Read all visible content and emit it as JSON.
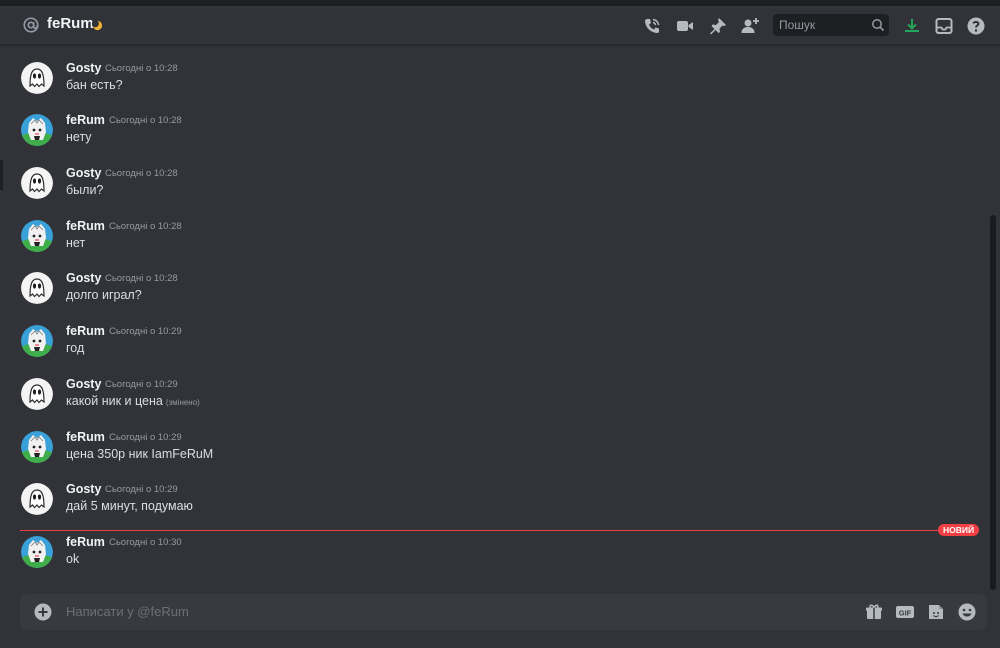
{
  "header": {
    "title": "feRum",
    "search_placeholder": "Пошук",
    "icons": [
      "at-icon",
      "moon-icon",
      "voice-call-icon",
      "video-call-icon",
      "pin-icon",
      "add-friend-icon",
      "search-icon",
      "download-icon",
      "inbox-icon",
      "help-icon"
    ]
  },
  "messages": [
    {
      "author": "Gosty",
      "timestamp": "Сьогодні о 10:28",
      "text": "бан есть?",
      "avatar": "ghost-avatar"
    },
    {
      "author": "feRum",
      "timestamp": "Сьогодні о 10:28",
      "text": "нету",
      "avatar": "anime-avatar"
    },
    {
      "author": "Gosty",
      "timestamp": "Сьогодні о 10:28",
      "text": "были?",
      "avatar": "ghost-avatar"
    },
    {
      "author": "feRum",
      "timestamp": "Сьогодні о 10:28",
      "text": "нет",
      "avatar": "anime-avatar"
    },
    {
      "author": "Gosty",
      "timestamp": "Сьогодні о 10:28",
      "text": "долго играл?",
      "avatar": "ghost-avatar"
    },
    {
      "author": "feRum",
      "timestamp": "Сьогодні о 10:29",
      "text": "год",
      "avatar": "anime-avatar"
    },
    {
      "author": "Gosty",
      "timestamp": "Сьогодні о 10:29",
      "text": "какой ник и цена",
      "edited": "(змінено)",
      "avatar": "ghost-avatar"
    },
    {
      "author": "feRum",
      "timestamp": "Сьогодні о 10:29",
      "text": "цена 350р ник IamFeRuM",
      "avatar": "anime-avatar"
    },
    {
      "author": "Gosty",
      "timestamp": "Сьогодні о 10:29",
      "text": "дай 5 минут, подумаю",
      "avatar": "ghost-avatar"
    },
    {
      "author": "feRum",
      "timestamp": "Сьогодні о 10:30",
      "text": "ok",
      "avatar": "anime-avatar"
    }
  ],
  "new_divider": {
    "label": "НОВИЙ",
    "color": "#f23f43"
  },
  "composer": {
    "placeholder": "Написати у @feRum",
    "icons": [
      "add-attachment-icon",
      "gift-icon",
      "gif-icon",
      "sticker-icon",
      "emoji-icon"
    ]
  },
  "colors": {
    "background": "#313338",
    "header": "#313338",
    "composer": "#383a40",
    "accent_red": "#f23f43",
    "download_green": "#23a55a"
  }
}
